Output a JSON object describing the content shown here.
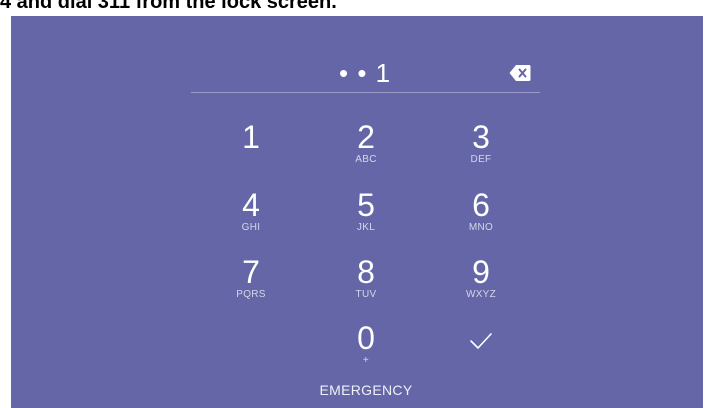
{
  "caption": "4 and dial 311 from the lock screen.",
  "pin": {
    "entry_display": "• • 1",
    "backspace_icon": "backspace-icon"
  },
  "keypad": [
    {
      "digit": "1",
      "letters": ""
    },
    {
      "digit": "2",
      "letters": "ABC"
    },
    {
      "digit": "3",
      "letters": "DEF"
    },
    {
      "digit": "4",
      "letters": "GHI"
    },
    {
      "digit": "5",
      "letters": "JKL"
    },
    {
      "digit": "6",
      "letters": "MNO"
    },
    {
      "digit": "7",
      "letters": "PQRS"
    },
    {
      "digit": "8",
      "letters": "TUV"
    },
    {
      "digit": "9",
      "letters": "WXYZ"
    },
    {
      "digit": "0",
      "letters": "+"
    }
  ],
  "enter_icon": "checkmark-icon",
  "emergency_label": "EMERGENCY",
  "colors": {
    "background": "#6466a8",
    "text": "#ffffff"
  }
}
